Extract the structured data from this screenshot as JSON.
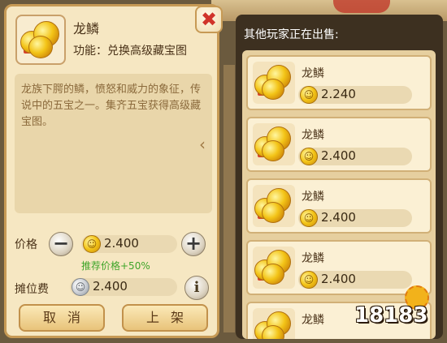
{
  "detail": {
    "item_name": "龙鳞",
    "function_text": "功能：兑换高级藏宝图",
    "description": "龙族下腭的鳞，愤怒和威力的象征，传说中的五宝之一。集齐五宝获得高级藏宝图。",
    "close_symbol": "✖",
    "price_label": "价格",
    "price_value": "2.400",
    "recommend_text": "推荐价格+50%",
    "fee_label": "摊位费",
    "fee_value": "2.400",
    "minus_symbol": "−",
    "plus_symbol": "+",
    "info_symbol": "i",
    "collapse_symbol": "‹",
    "cancel_label": "取消",
    "list_label": "上架"
  },
  "market": {
    "title": "其他玩家正在出售:",
    "listings": [
      {
        "name": "龙鳞",
        "price": "2.240"
      },
      {
        "name": "龙鳞",
        "price": "2.400"
      },
      {
        "name": "龙鳞",
        "price": "2.400"
      },
      {
        "name": "龙鳞",
        "price": "2.400"
      },
      {
        "name": "龙鳞",
        "price": ""
      }
    ]
  },
  "icons": {
    "gold_coin": "gold-coin-icon",
    "silver_coin": "silver-coin-icon",
    "dragon_scale": "dragon-scale-icon"
  },
  "colors": {
    "panel_bg": "#f6e7c2",
    "panel_border": "#c79a55",
    "close_red": "#d0342a",
    "recommend_green": "#3fa52a"
  },
  "watermark": {
    "text": "18183"
  }
}
